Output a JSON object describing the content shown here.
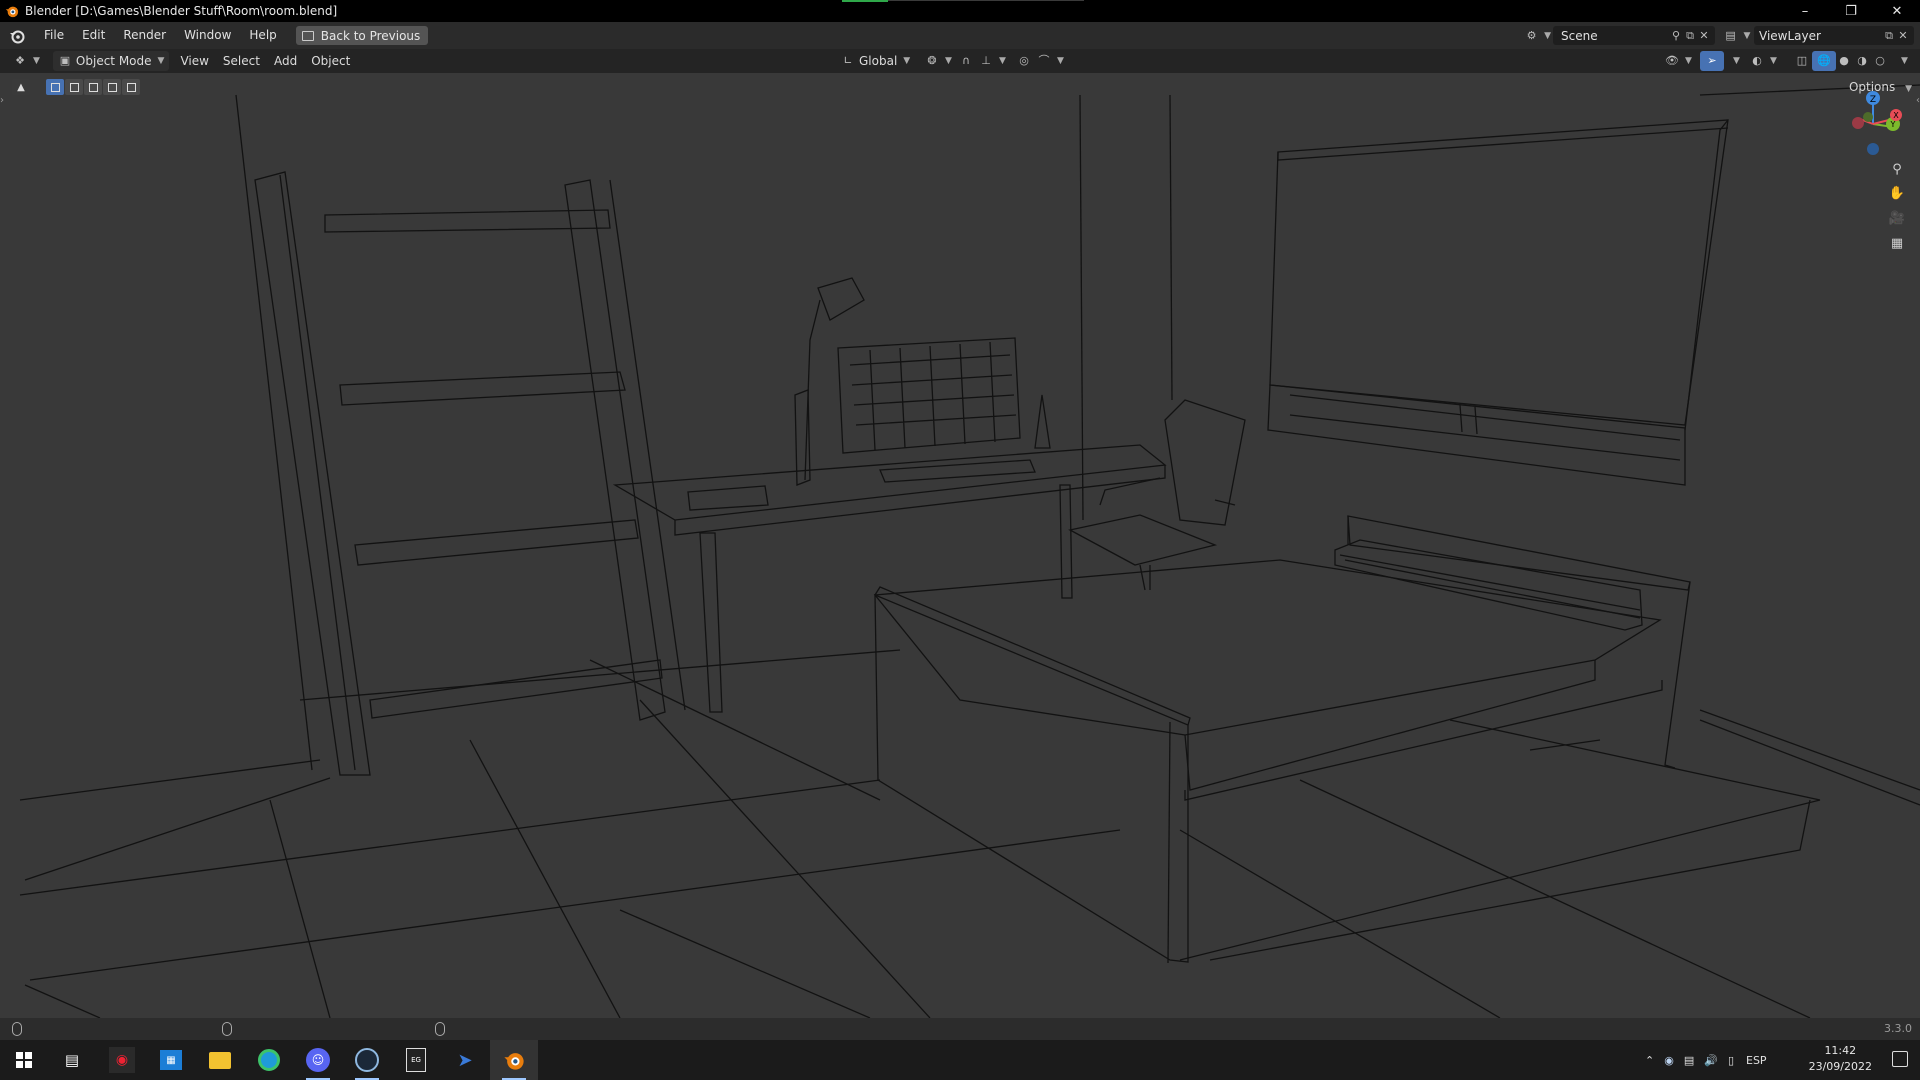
{
  "window": {
    "title": "Blender [D:\\Games\\Blender Stuff\\Room\\room.blend]",
    "controls": [
      "minimize-icon",
      "restore-icon",
      "close-icon"
    ]
  },
  "menubar": {
    "items": [
      "File",
      "Edit",
      "Render",
      "Window",
      "Help"
    ],
    "back_button": "Back to Previous",
    "scene_label": "Scene",
    "viewlayer_label": "ViewLayer"
  },
  "viewport_header": {
    "mode": "Object Mode",
    "menus": [
      "View",
      "Select",
      "Add",
      "Object"
    ],
    "transform_orientation": "Global"
  },
  "viewport": {
    "options_label": "Options",
    "gizmo_axes": [
      "Z",
      "Y",
      "X"
    ],
    "shading": "wireframe",
    "colors": {
      "background": "#393939",
      "wire": "#111111",
      "x_axis": "#e84c56",
      "y_axis": "#7cba2c",
      "z_axis": "#3f8ae0"
    }
  },
  "statusbar": {
    "version": "3.3.0"
  },
  "taskbar": {
    "apps": [
      "windows-start-icon",
      "task-view-icon",
      "amd-radeon-icon",
      "microsoft-store-icon",
      "file-explorer-icon",
      "edge-icon",
      "discord-icon",
      "steam-icon",
      "epic-games-icon",
      "gaming-app-icon",
      "blender-icon"
    ],
    "active_app": "blender-icon",
    "language": "ESP",
    "time": "11:42",
    "date": "23/09/2022"
  }
}
